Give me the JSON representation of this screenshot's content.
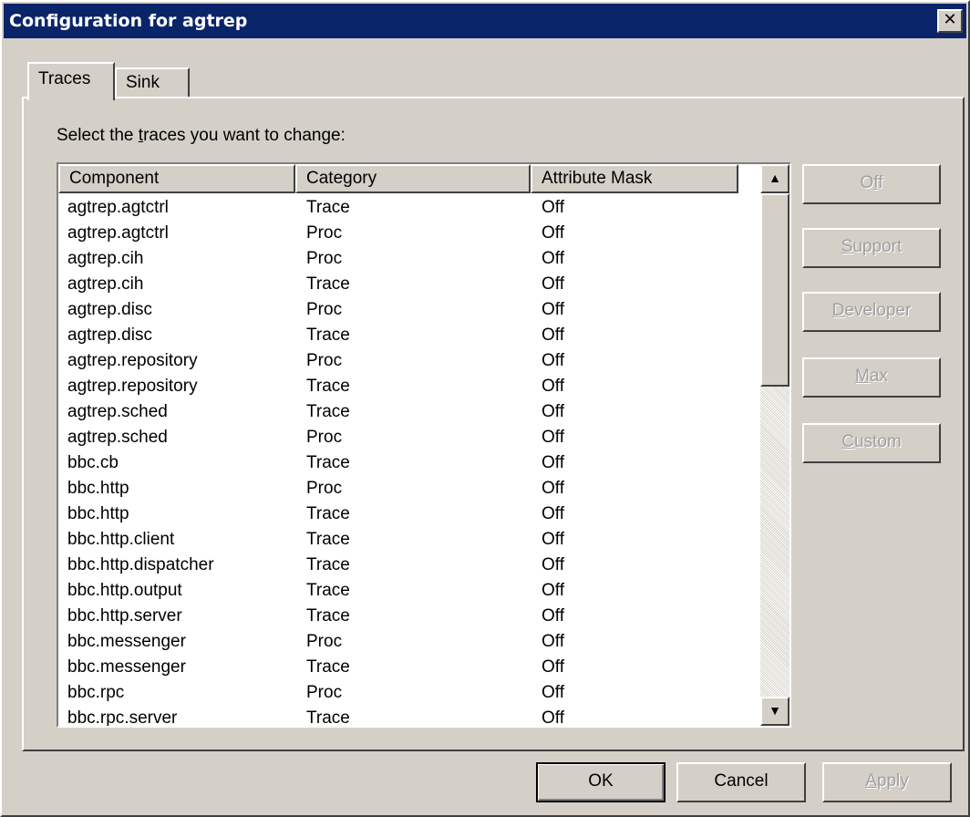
{
  "window": {
    "title": "Configuration for agtrep",
    "close_glyph": "✕"
  },
  "tabs": [
    {
      "label": "Traces",
      "selected": true
    },
    {
      "label": "Sink",
      "selected": false
    }
  ],
  "prompt": {
    "before": "Select the ",
    "accesskey": "t",
    "after": "races you want to change:"
  },
  "table": {
    "columns": [
      "Component",
      "Category",
      "Attribute Mask"
    ],
    "rows": [
      [
        "agtrep.agtctrl",
        "Trace",
        "Off"
      ],
      [
        "agtrep.agtctrl",
        "Proc",
        "Off"
      ],
      [
        "agtrep.cih",
        "Proc",
        "Off"
      ],
      [
        "agtrep.cih",
        "Trace",
        "Off"
      ],
      [
        "agtrep.disc",
        "Proc",
        "Off"
      ],
      [
        "agtrep.disc",
        "Trace",
        "Off"
      ],
      [
        "agtrep.repository",
        "Proc",
        "Off"
      ],
      [
        "agtrep.repository",
        "Trace",
        "Off"
      ],
      [
        "agtrep.sched",
        "Trace",
        "Off"
      ],
      [
        "agtrep.sched",
        "Proc",
        "Off"
      ],
      [
        "bbc.cb",
        "Trace",
        "Off"
      ],
      [
        "bbc.http",
        "Proc",
        "Off"
      ],
      [
        "bbc.http",
        "Trace",
        "Off"
      ],
      [
        "bbc.http.client",
        "Trace",
        "Off"
      ],
      [
        "bbc.http.dispatcher",
        "Trace",
        "Off"
      ],
      [
        "bbc.http.output",
        "Trace",
        "Off"
      ],
      [
        "bbc.http.server",
        "Trace",
        "Off"
      ],
      [
        "bbc.messenger",
        "Proc",
        "Off"
      ],
      [
        "bbc.messenger",
        "Trace",
        "Off"
      ],
      [
        "bbc.rpc",
        "Proc",
        "Off"
      ],
      [
        "bbc.rpc.server",
        "Trace",
        "Off"
      ]
    ]
  },
  "scrollbar": {
    "up_glyph": "▲",
    "down_glyph": "▼"
  },
  "side_buttons": [
    {
      "pre": "O",
      "key": "f",
      "post": "f",
      "enabled": false
    },
    {
      "pre": "",
      "key": "S",
      "post": "upport",
      "enabled": false
    },
    {
      "pre": "",
      "key": "D",
      "post": "eveloper",
      "enabled": false
    },
    {
      "pre": "",
      "key": "M",
      "post": "ax",
      "enabled": false
    },
    {
      "pre": "",
      "key": "C",
      "post": "ustom",
      "enabled": false
    }
  ],
  "bottom_buttons": {
    "ok": "OK",
    "cancel": "Cancel",
    "apply": {
      "pre": "",
      "key": "A",
      "post": "pply",
      "enabled": false
    }
  }
}
